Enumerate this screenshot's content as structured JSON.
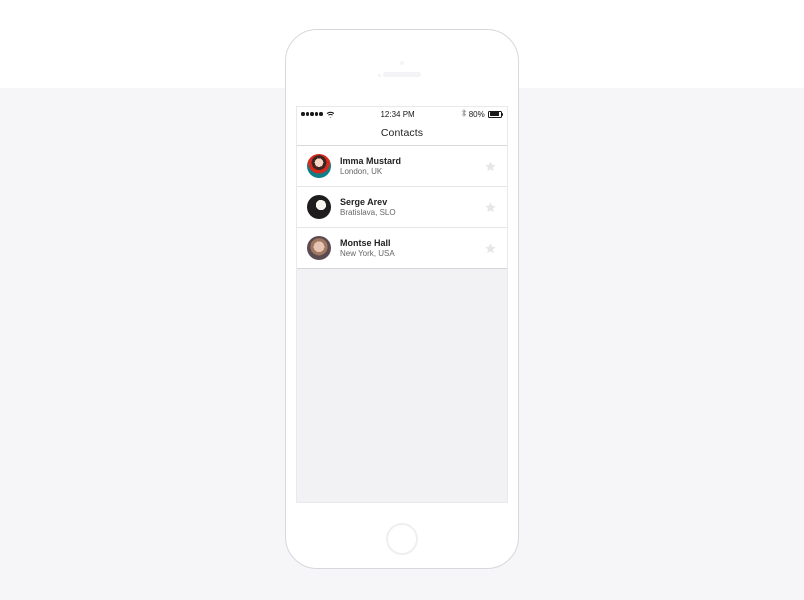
{
  "statusbar": {
    "time": "12:34 PM",
    "battery_text": "80%"
  },
  "navbar": {
    "title": "Contacts"
  },
  "contacts": [
    {
      "name": "Imma Mustard",
      "location": "London, UK"
    },
    {
      "name": "Serge Arev",
      "location": "Bratislava, SLO"
    },
    {
      "name": "Montse Hall",
      "location": "New York, USA"
    }
  ]
}
